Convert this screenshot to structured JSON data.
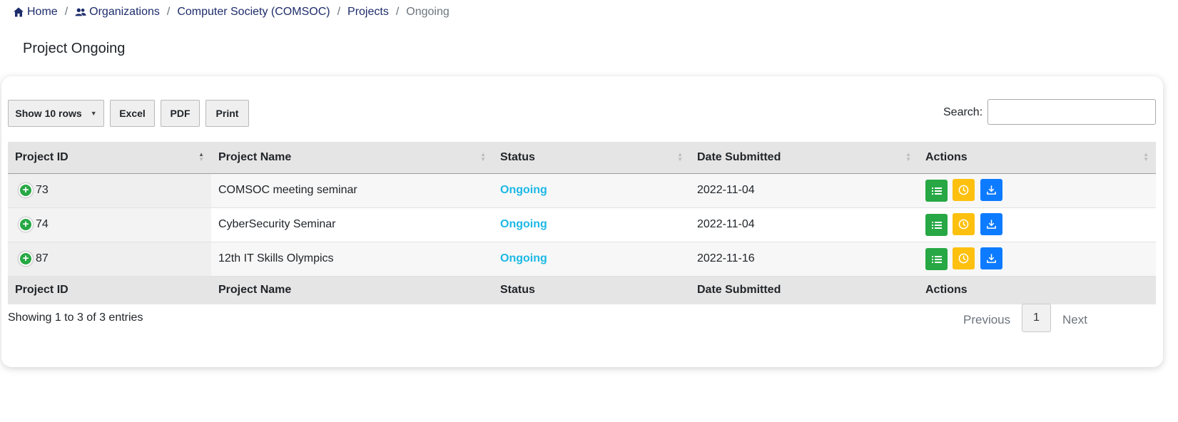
{
  "breadcrumb": {
    "home": "Home",
    "organizations": "Organizations",
    "organization": "Computer Society (COMSOC)",
    "projects": "Projects",
    "current": "Ongoing",
    "separator": "/"
  },
  "page_title": "Project Ongoing",
  "toolbar": {
    "show_rows": "Show 10 rows",
    "excel": "Excel",
    "pdf": "PDF",
    "print": "Print",
    "search_label": "Search:",
    "search_value": ""
  },
  "table": {
    "headers": [
      "Project ID",
      "Project Name",
      "Status",
      "Date Submitted",
      "Actions"
    ],
    "rows": [
      {
        "id": "73",
        "name": "COMSOC meeting seminar",
        "status": "Ongoing",
        "date": "2022-11-04"
      },
      {
        "id": "74",
        "name": "CyberSecurity Seminar",
        "status": "Ongoing",
        "date": "2022-11-04"
      },
      {
        "id": "87",
        "name": "12th IT Skills Olympics",
        "status": "Ongoing",
        "date": "2022-11-16"
      }
    ],
    "footers": [
      "Project ID",
      "Project Name",
      "Status",
      "Date Submitted",
      "Actions"
    ]
  },
  "info": "Showing 1 to 3 of 3 entries",
  "pagination": {
    "previous": "Previous",
    "current": "1",
    "next": "Next"
  },
  "colors": {
    "breadcrumb_link": "#1d2c6b",
    "status_ongoing": "#1cb8e6",
    "action_view": "#27a844",
    "action_history": "#fdc00f",
    "action_download": "#0d7bff"
  },
  "icons": {
    "home": "home-icon",
    "organizations": "users-icon",
    "expand": "plus-circle-icon",
    "view": "list-icon",
    "history": "clock-icon",
    "download": "download-icon"
  }
}
